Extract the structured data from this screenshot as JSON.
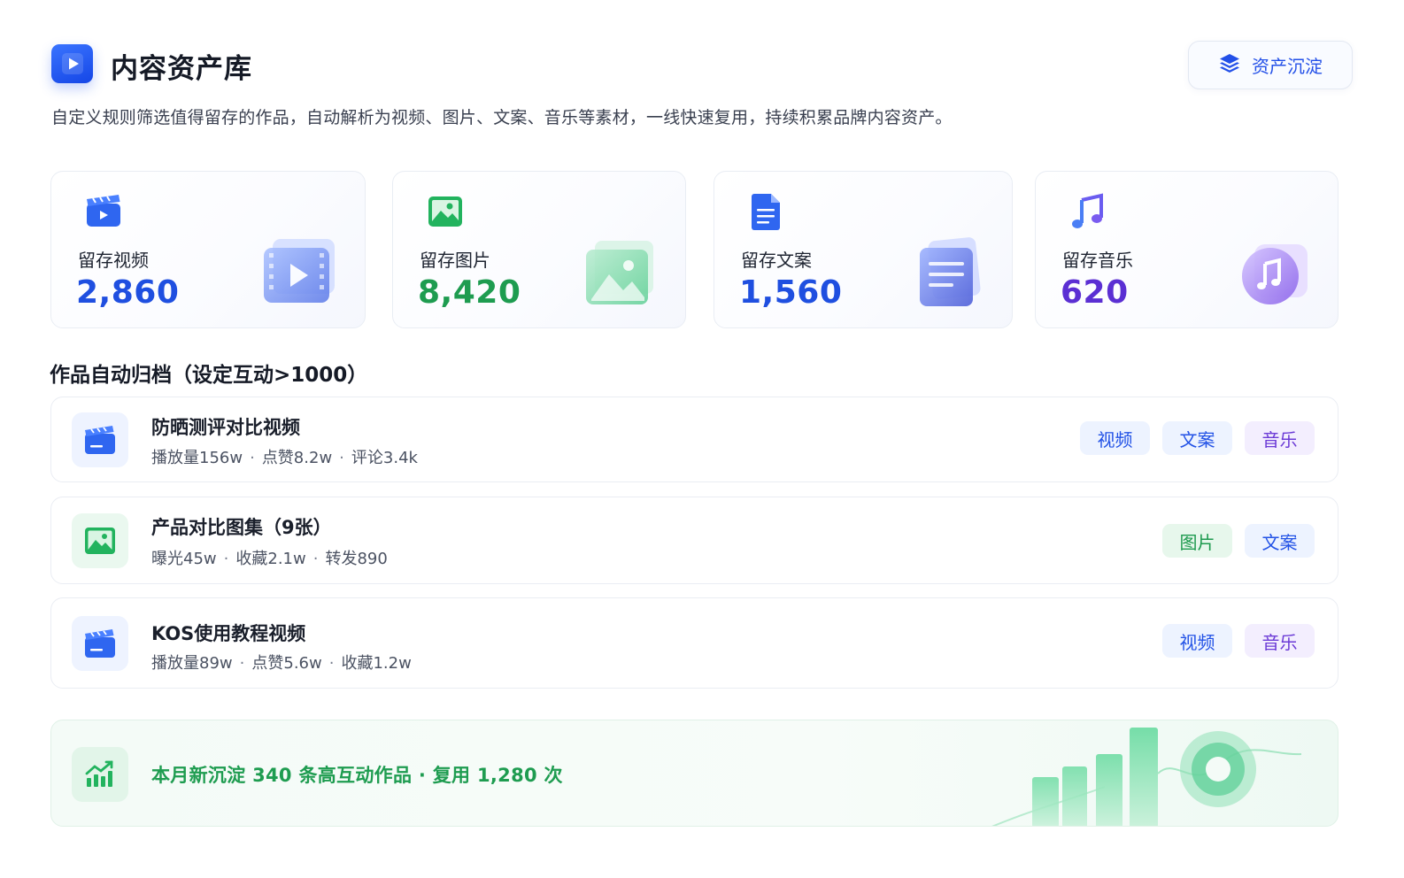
{
  "header": {
    "title": "内容资产库",
    "description": "自定义规则筛选值得留存的作品，自动解析为视频、图片、文案、音乐等素材，一线快速复用，持续积累品牌内容资产。",
    "action_button": {
      "label": "资产沉淀",
      "icon": "layers-icon"
    }
  },
  "stats": [
    {
      "label": "留存视频",
      "value": "2,860",
      "icon": "video-clapper-icon",
      "color": "#1f4fe0"
    },
    {
      "label": "留存图片",
      "value": "8,420",
      "icon": "image-icon",
      "color": "#1e9c50"
    },
    {
      "label": "留存文案",
      "value": "1,560",
      "icon": "document-icon",
      "color": "#1f4fe0"
    },
    {
      "label": "留存音乐",
      "value": "620",
      "icon": "music-note-icon",
      "color": "#5b2fd3"
    }
  ],
  "section": {
    "title": "作品自动归档（设定互动>1000）"
  },
  "items": [
    {
      "title": "防晒测评对比视频",
      "icon": "video-clapper-icon",
      "metrics": [
        "播放量156w",
        "点赞8.2w",
        "评论3.4k"
      ],
      "tags": [
        "视频",
        "文案",
        "音乐"
      ]
    },
    {
      "title": "产品对比图集（9张）",
      "icon": "image-icon",
      "metrics": [
        "曝光45w",
        "收藏2.1w",
        "转发890"
      ],
      "tags": [
        "图片",
        "文案"
      ]
    },
    {
      "title": "KOS使用教程视频",
      "icon": "video-clapper-icon",
      "metrics": [
        "播放量89w",
        "点赞5.6w",
        "收藏1.2w"
      ],
      "tags": [
        "视频",
        "音乐"
      ]
    }
  ],
  "summary": {
    "text": "本月新沉淀 340 条高互动作品 · 复用 1,280 次",
    "icon": "trend-chart-icon"
  }
}
